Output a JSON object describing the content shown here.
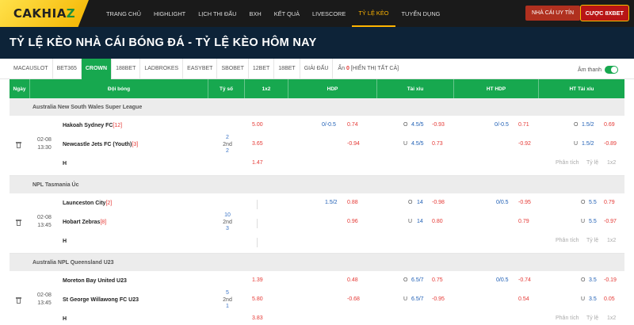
{
  "nav": {
    "logo": {
      "part1": "CAKHIA",
      "part2": "Z"
    },
    "menu": [
      "TRANG CHỦ",
      "HIGHLIGHT",
      "LỊCH THI ĐẤU",
      "BXH",
      "KẾT QUẢ",
      "LIVESCORE",
      "TỶ LỆ KÈO",
      "TUYỂN DỤNG"
    ],
    "active_index": 6,
    "btn_nhacai": "NHÀ CÁI UY TÍN",
    "btn_cuoc": "CƯỢC 8XBET"
  },
  "page_title": "TỶ LỆ KÈO NHÀ CÁI BÓNG ĐÁ - TỶ LỆ KÈO HÔM NAY",
  "filter": {
    "tabs": [
      "MACAUSLOT",
      "BET365",
      "CROWN",
      "188BET",
      "LADBROKES",
      "EASYBET",
      "SBOBET",
      "12BET",
      "18BET",
      "GIẢI ĐẤU"
    ],
    "active_index": 2,
    "hidden_label": "Ẩn",
    "hidden_count": "0",
    "show_all": "[HIỂN THỊ TẤT CẢ]",
    "sound_label": "Âm thanh",
    "sound_on": true
  },
  "table": {
    "headers": [
      "Ngày",
      "Đội bóng",
      "Tỷ số",
      "1x2",
      "HDP",
      "Tài xỉu",
      "HT HDP",
      "HT Tài xỉu"
    ],
    "leagues": [
      {
        "name": "Australia New South Wales Super League",
        "match": {
          "date": "02-08",
          "time": "13:30",
          "home": "Hakoah Sydney FC",
          "home_rank": "[12]",
          "away": "Newcastle Jets FC (Youth)",
          "away_rank": "[3]",
          "draw_label": "H",
          "score_home": "2",
          "period": "2nd",
          "score_away": "2",
          "x12": [
            "5.00",
            "3.65",
            "1.47"
          ],
          "hdp_line1": "0/-0.5",
          "hdp_odd1": "0.74",
          "hdp_odd2": "-0.94",
          "tx_o": "O",
          "tx_line1": "4.5/5",
          "tx_odd1": "-0.93",
          "tx_u": "U",
          "tx_line2": "4.5/5",
          "tx_odd2": "0.73",
          "hthdp_line1": "0/-0.5",
          "hthdp_odd1": "0.71",
          "hthdp_odd2": "-0.92",
          "httx_o": "O",
          "httx_line1": "1.5/2",
          "httx_odd1": "0.69",
          "httx_u": "U",
          "httx_line2": "1.5/2",
          "httx_odd2": "-0.89",
          "links": [
            "Phân tích",
            "Tỷ lệ",
            "1x2"
          ]
        }
      },
      {
        "name": "NPL Tasmania Úc",
        "match": {
          "date": "02-08",
          "time": "13:45",
          "home": "Launceston City",
          "home_rank": "[2]",
          "away": "Hobart Zebras",
          "away_rank": "[8]",
          "draw_label": "H",
          "score_home": "10",
          "period": "2nd",
          "score_away": "3",
          "x12": [
            "",
            "",
            ""
          ],
          "hdp_line1": "1.5/2",
          "hdp_odd1": "0.88",
          "hdp_odd2": "0.96",
          "tx_o": "O",
          "tx_line1": "14",
          "tx_odd1": "-0.98",
          "tx_u": "U",
          "tx_line2": "14",
          "tx_odd2": "0.80",
          "hthdp_line1": "0/0.5",
          "hthdp_odd1": "-0.95",
          "hthdp_odd2": "0.79",
          "httx_o": "O",
          "httx_line1": "5.5",
          "httx_odd1": "0.79",
          "httx_u": "U",
          "httx_line2": "5.5",
          "httx_odd2": "-0.97",
          "links": [
            "Phân tích",
            "Tỷ lệ",
            "1x2"
          ]
        }
      },
      {
        "name": "Australia NPL Queensland U23",
        "match": {
          "date": "02-08",
          "time": "13:45",
          "home": "Moreton Bay United U23",
          "home_rank": "",
          "away": "St George Willawong FC U23",
          "away_rank": "",
          "draw_label": "H",
          "score_home": "5",
          "period": "2nd",
          "score_away": "1",
          "x12": [
            "1.39",
            "5.80",
            "3.83"
          ],
          "hdp_line1": "",
          "hdp_odd1": "0.48",
          "hdp_odd2": "-0.68",
          "tx_o": "O",
          "tx_line1": "6.5/7",
          "tx_odd1": "0.75",
          "tx_u": "U",
          "tx_line2": "6.5/7",
          "tx_odd2": "-0.95",
          "hthdp_line1": "0/0.5",
          "hthdp_odd1": "-0.74",
          "hthdp_odd2": "0.54",
          "httx_o": "O",
          "httx_line1": "3.5",
          "httx_odd1": "-0.19",
          "httx_u": "U",
          "httx_line2": "3.5",
          "httx_odd2": "0.05",
          "links": [
            "Phân tích",
            "Tỷ lệ",
            "1x2"
          ]
        }
      }
    ]
  }
}
